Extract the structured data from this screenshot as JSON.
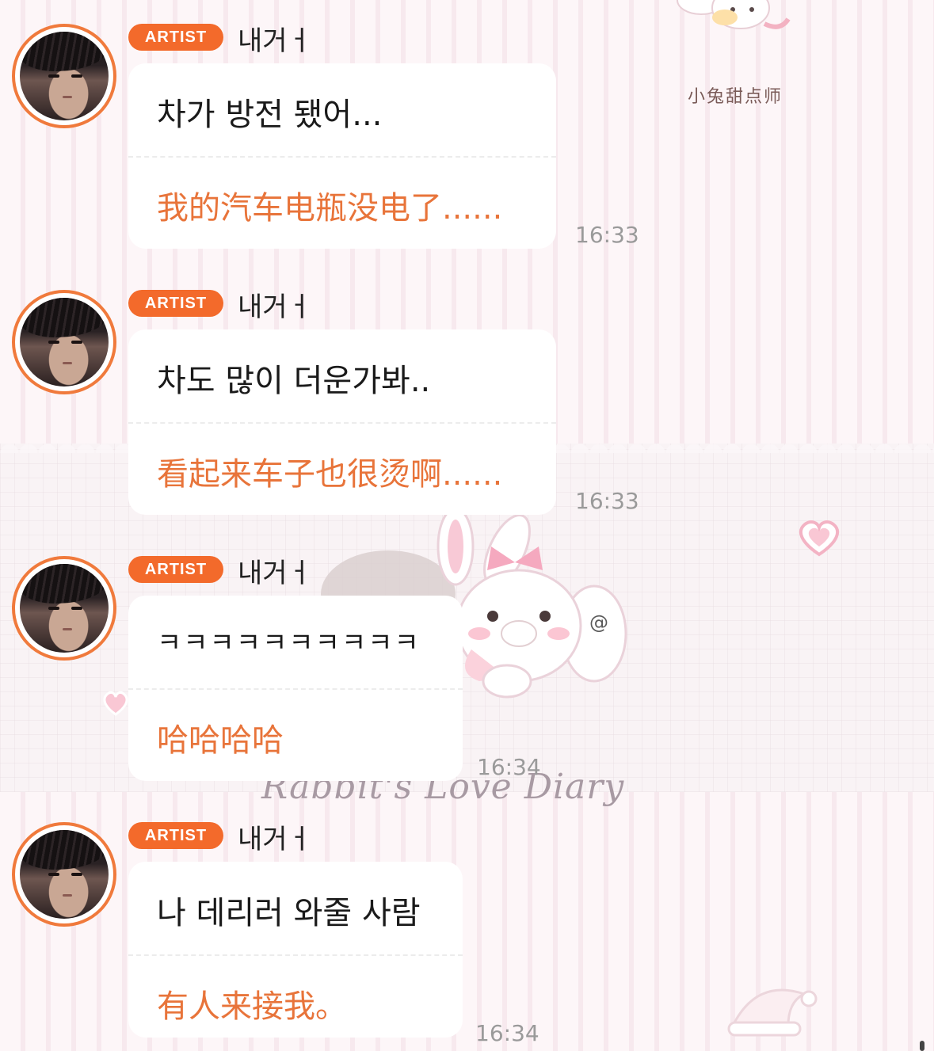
{
  "messages": [
    {
      "badge": "ARTIST",
      "nickname": "내거ㅓ",
      "korean": "차가 방전 됐어...",
      "chinese": "我的汽车电瓶没电了......",
      "time": "16:33"
    },
    {
      "badge": "ARTIST",
      "nickname": "내거ㅓ",
      "korean": "차도 많이 더운가봐..",
      "chinese": "看起来车子也很烫啊......",
      "time": "16:33"
    },
    {
      "badge": "ARTIST",
      "nickname": "내거ㅓ",
      "korean": "ㅋㅋㅋㅋㅋㅋㅋㅋㅋㅋ",
      "chinese": "哈哈哈哈",
      "time": "16:34"
    },
    {
      "badge": "ARTIST",
      "nickname": "내거ㅓ",
      "korean": "나 데리러 와줄 사람",
      "chinese": "有人来接我。",
      "time": "16:34"
    }
  ],
  "background": {
    "sticker_caption": "小兔甜点师",
    "diary_text": "Rabbit's Love Diary",
    "mention_symbol": "@"
  },
  "colors": {
    "accent": "#f36a2b",
    "translation_text": "#e8743a",
    "avatar_ring": "#f07a3c"
  }
}
